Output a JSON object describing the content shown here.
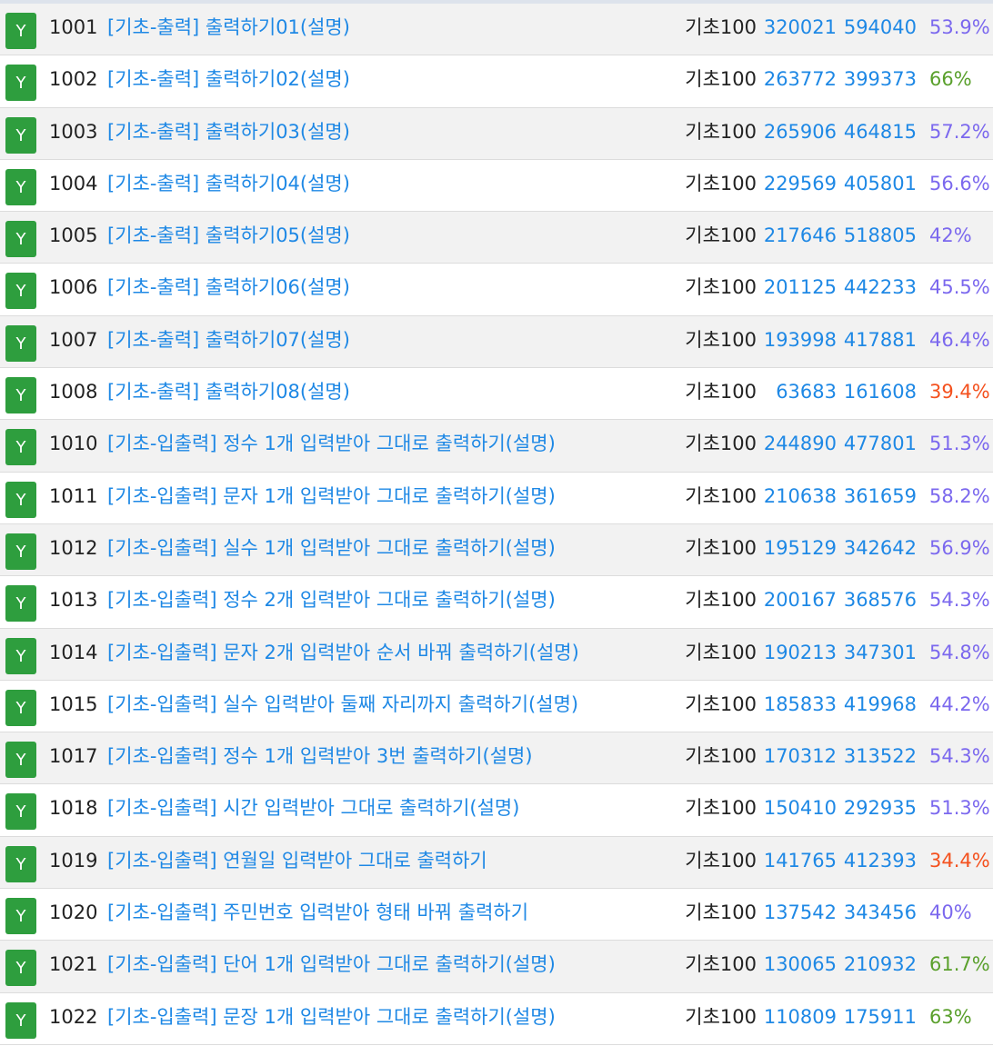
{
  "colors": {
    "badge": "#2e9e3e",
    "link": "#1e88e5",
    "rate_normal": "#7b68ee",
    "rate_high": "#5aa02c",
    "rate_low": "#f4511e"
  },
  "problems": [
    {
      "badge": "Y",
      "id": "1001",
      "title": "[기초-출력] 출력하기01(설명)",
      "category": "기초100",
      "solved": "320021",
      "submissions": "594040",
      "rate": "53.9%",
      "rate_color": "#7b68ee"
    },
    {
      "badge": "Y",
      "id": "1002",
      "title": "[기초-출력] 출력하기02(설명)",
      "category": "기초100",
      "solved": "263772",
      "submissions": "399373",
      "rate": "66%",
      "rate_color": "#5aa02c"
    },
    {
      "badge": "Y",
      "id": "1003",
      "title": "[기초-출력] 출력하기03(설명)",
      "category": "기초100",
      "solved": "265906",
      "submissions": "464815",
      "rate": "57.2%",
      "rate_color": "#7b68ee"
    },
    {
      "badge": "Y",
      "id": "1004",
      "title": "[기초-출력] 출력하기04(설명)",
      "category": "기초100",
      "solved": "229569",
      "submissions": "405801",
      "rate": "56.6%",
      "rate_color": "#7b68ee"
    },
    {
      "badge": "Y",
      "id": "1005",
      "title": "[기초-출력] 출력하기05(설명)",
      "category": "기초100",
      "solved": "217646",
      "submissions": "518805",
      "rate": "42%",
      "rate_color": "#7b68ee"
    },
    {
      "badge": "Y",
      "id": "1006",
      "title": "[기초-출력] 출력하기06(설명)",
      "category": "기초100",
      "solved": "201125",
      "submissions": "442233",
      "rate": "45.5%",
      "rate_color": "#7b68ee"
    },
    {
      "badge": "Y",
      "id": "1007",
      "title": "[기초-출력] 출력하기07(설명)",
      "category": "기초100",
      "solved": "193998",
      "submissions": "417881",
      "rate": "46.4%",
      "rate_color": "#7b68ee"
    },
    {
      "badge": "Y",
      "id": "1008",
      "title": "[기초-출력] 출력하기08(설명)",
      "category": "기초100",
      "solved": "63683",
      "submissions": "161608",
      "rate": "39.4%",
      "rate_color": "#f4511e"
    },
    {
      "badge": "Y",
      "id": "1010",
      "title": "[기초-입출력] 정수 1개 입력받아 그대로 출력하기(설명)",
      "category": "기초100",
      "solved": "244890",
      "submissions": "477801",
      "rate": "51.3%",
      "rate_color": "#7b68ee"
    },
    {
      "badge": "Y",
      "id": "1011",
      "title": "[기초-입출력] 문자 1개 입력받아 그대로 출력하기(설명)",
      "category": "기초100",
      "solved": "210638",
      "submissions": "361659",
      "rate": "58.2%",
      "rate_color": "#7b68ee"
    },
    {
      "badge": "Y",
      "id": "1012",
      "title": "[기초-입출력] 실수 1개 입력받아 그대로 출력하기(설명)",
      "category": "기초100",
      "solved": "195129",
      "submissions": "342642",
      "rate": "56.9%",
      "rate_color": "#7b68ee"
    },
    {
      "badge": "Y",
      "id": "1013",
      "title": "[기초-입출력] 정수 2개 입력받아 그대로 출력하기(설명)",
      "category": "기초100",
      "solved": "200167",
      "submissions": "368576",
      "rate": "54.3%",
      "rate_color": "#7b68ee"
    },
    {
      "badge": "Y",
      "id": "1014",
      "title": "[기초-입출력] 문자 2개 입력받아 순서 바꿔 출력하기(설명)",
      "category": "기초100",
      "solved": "190213",
      "submissions": "347301",
      "rate": "54.8%",
      "rate_color": "#7b68ee"
    },
    {
      "badge": "Y",
      "id": "1015",
      "title": "[기초-입출력] 실수 입력받아 둘째 자리까지 출력하기(설명)",
      "category": "기초100",
      "solved": "185833",
      "submissions": "419968",
      "rate": "44.2%",
      "rate_color": "#7b68ee"
    },
    {
      "badge": "Y",
      "id": "1017",
      "title": "[기초-입출력] 정수 1개 입력받아 3번 출력하기(설명)",
      "category": "기초100",
      "solved": "170312",
      "submissions": "313522",
      "rate": "54.3%",
      "rate_color": "#7b68ee"
    },
    {
      "badge": "Y",
      "id": "1018",
      "title": "[기초-입출력] 시간 입력받아 그대로 출력하기(설명)",
      "category": "기초100",
      "solved": "150410",
      "submissions": "292935",
      "rate": "51.3%",
      "rate_color": "#7b68ee"
    },
    {
      "badge": "Y",
      "id": "1019",
      "title": "[기초-입출력] 연월일 입력받아 그대로 출력하기",
      "category": "기초100",
      "solved": "141765",
      "submissions": "412393",
      "rate": "34.4%",
      "rate_color": "#f4511e"
    },
    {
      "badge": "Y",
      "id": "1020",
      "title": "[기초-입출력] 주민번호 입력받아 형태 바꿔 출력하기",
      "category": "기초100",
      "solved": "137542",
      "submissions": "343456",
      "rate": "40%",
      "rate_color": "#7b68ee"
    },
    {
      "badge": "Y",
      "id": "1021",
      "title": "[기초-입출력] 단어 1개 입력받아 그대로 출력하기(설명)",
      "category": "기초100",
      "solved": "130065",
      "submissions": "210932",
      "rate": "61.7%",
      "rate_color": "#5aa02c"
    },
    {
      "badge": "Y",
      "id": "1022",
      "title": "[기초-입출력] 문장 1개 입력받아 그대로 출력하기(설명)",
      "category": "기초100",
      "solved": "110809",
      "submissions": "175911",
      "rate": "63%",
      "rate_color": "#5aa02c"
    }
  ]
}
